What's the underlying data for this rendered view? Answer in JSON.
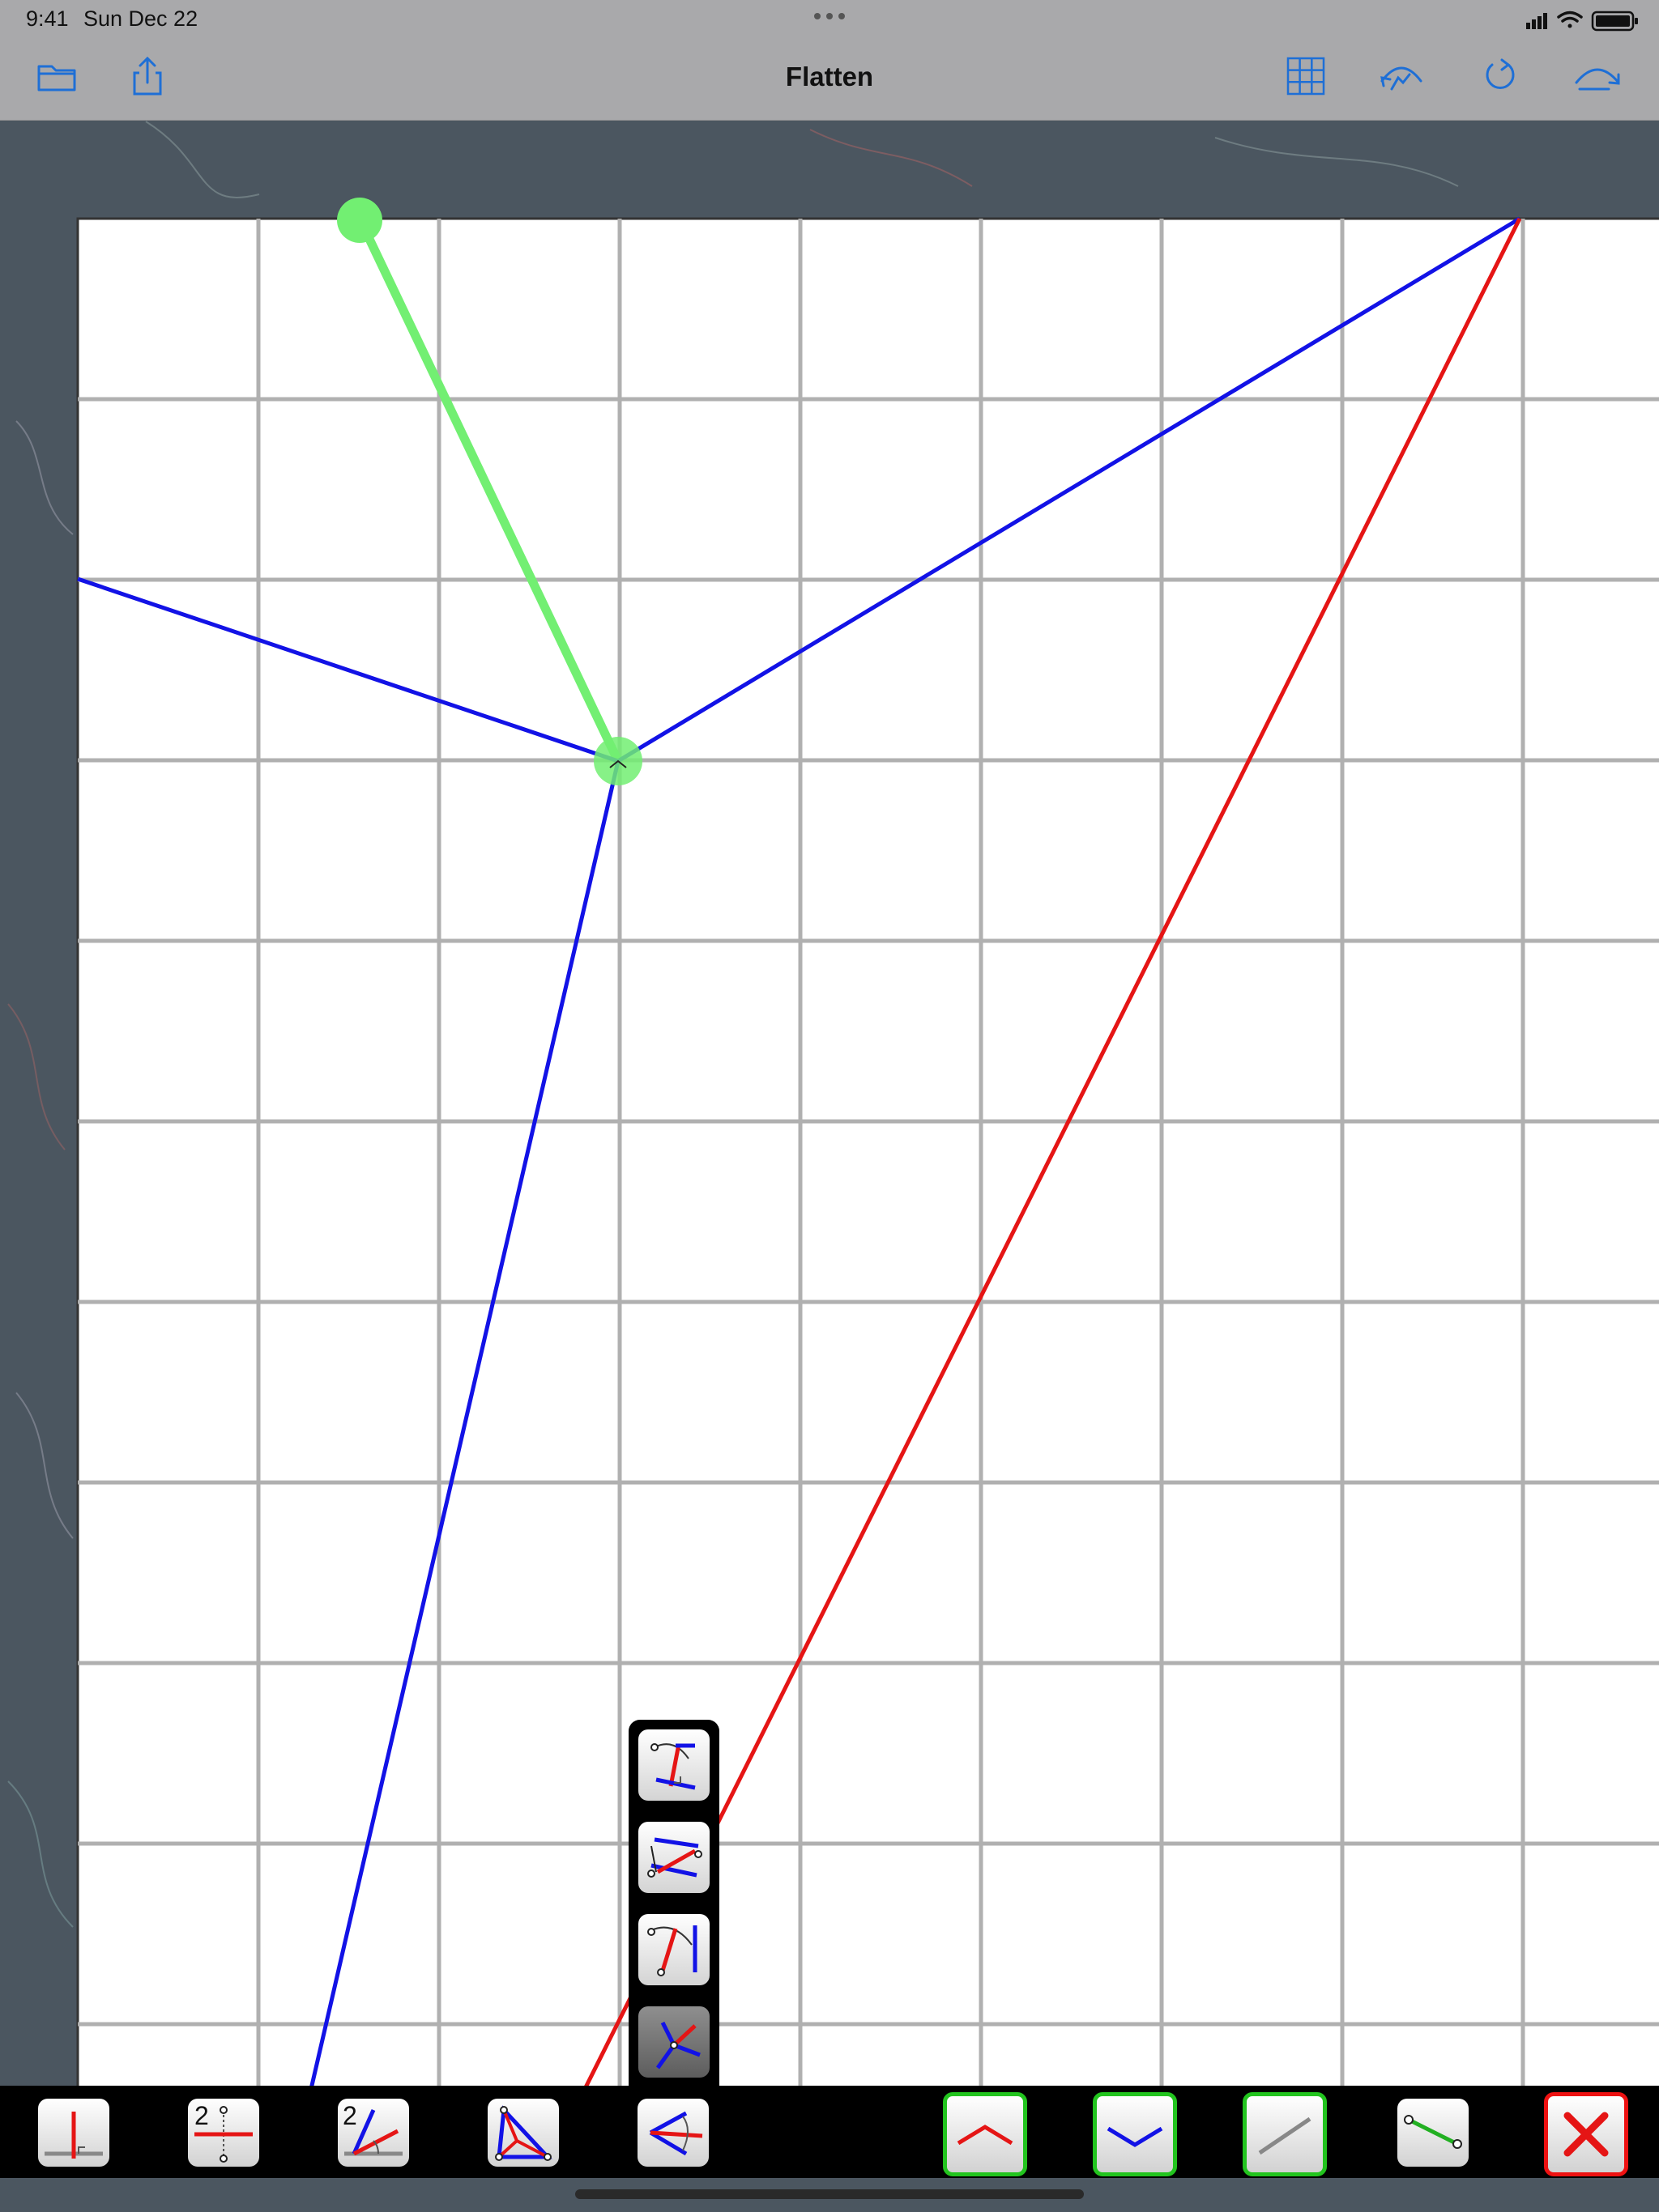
{
  "status_bar": {
    "time": "9:41",
    "date": "Sun Dec 22"
  },
  "nav_bar": {
    "title": "Flatten",
    "left_icons": [
      "folder-icon",
      "share-icon"
    ],
    "right_icons": [
      "grid-icon",
      "undo-icon",
      "rotate-icon",
      "redo-icon"
    ],
    "accent_color": "#1e6fd6"
  },
  "canvas": {
    "grid_color": "#b0b0b0",
    "mountain_color": "#e01010",
    "valley_color": "#1010e0",
    "selection_color": "#66ee66"
  },
  "tool_popup": {
    "tools": [
      "perpendicular-bisector-tool",
      "parallel-fold-tool",
      "angle-to-line-tool",
      "trisector-tool"
    ]
  },
  "bottom_toolbar": {
    "tools": [
      "perpendicular-tool",
      "midpoint-tool",
      "angle-bisector-tool",
      "incenter-tool",
      "point-to-line-tool",
      "mountain-fold-toggle",
      "valley-fold-toggle",
      "flat-fold-toggle",
      "segment-tool",
      "delete-button"
    ]
  }
}
